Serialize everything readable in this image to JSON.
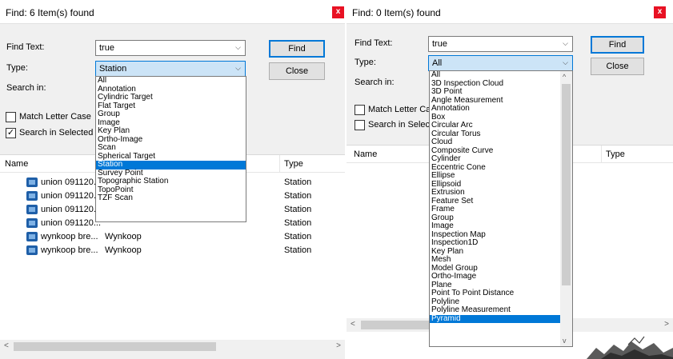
{
  "left_dialog": {
    "title": "Find: 6 Item(s) found",
    "close_glyph": "x",
    "find_text_label": "Find Text:",
    "find_text_value": "true",
    "type_label": "Type:",
    "type_value": "Station",
    "search_in_label": "Search in:",
    "find_button": "Find",
    "close_button": "Close",
    "match_case_label": "Match Letter Case",
    "match_case_checked": false,
    "search_selected_label": "Search in Selected",
    "search_selected_checked": true,
    "columns": [
      "Name",
      "Type"
    ],
    "rows": [
      {
        "name": "union 091120...",
        "type": "Station"
      },
      {
        "name": "union 091120...",
        "type": "Station"
      },
      {
        "name": "union 091120...",
        "type": "Station"
      },
      {
        "name": "union 091120...",
        "type": "Station"
      },
      {
        "name": "wynkoop bre...",
        "folder": "Wynkoop",
        "type": "Station"
      },
      {
        "name": "wynkoop bre...",
        "folder": "Wynkoop",
        "type": "Station"
      }
    ],
    "dropdown_options": [
      "All",
      "Annotation",
      "Cylindric Target",
      "Flat Target",
      "Group",
      "Image",
      "Key Plan",
      "Ortho-Image",
      "Scan",
      "Spherical Target",
      "Station",
      "Survey Point",
      "Topographic Station",
      "TopoPoint",
      "TZF Scan"
    ],
    "dropdown_selected": "Station",
    "scroll_left": "<",
    "scroll_right": ">"
  },
  "right_dialog": {
    "title": "Find: 0 Item(s) found",
    "close_glyph": "x",
    "find_text_label": "Find Text:",
    "find_text_value": "true",
    "type_label": "Type:",
    "type_value": "All",
    "search_in_label": "Search in:",
    "find_button": "Find",
    "close_button": "Close",
    "match_case_label": "Match Letter Case",
    "match_case_checked": false,
    "search_selected_label": "Search in Selected",
    "search_selected_checked": false,
    "columns": [
      "Name",
      "Type"
    ],
    "dropdown_options": [
      "All",
      "3D Inspection Cloud",
      "3D Point",
      "Angle Measurement",
      "Annotation",
      "Box",
      "Circular Arc",
      "Circular Torus",
      "Cloud",
      "Composite Curve",
      "Cylinder",
      "Eccentric Cone",
      "Ellipse",
      "Ellipsoid",
      "Extrusion",
      "Feature Set",
      "Frame",
      "Group",
      "Image",
      "Inspection Map",
      "Inspection1D",
      "Key Plan",
      "Mesh",
      "Model Group",
      "Ortho-Image",
      "Plane",
      "Point To Point Distance",
      "Polyline",
      "Polyline Measurement",
      "Pyramid"
    ],
    "dropdown_selected": "Pyramid",
    "scroll_up": "^",
    "scroll_down": "v",
    "scroll_left": "<",
    "scroll_right": ">"
  },
  "icons": {
    "dropdown_arrow": "chevron-down-icon",
    "row_icon": "scan-station-icon",
    "checkmark": "✓"
  }
}
